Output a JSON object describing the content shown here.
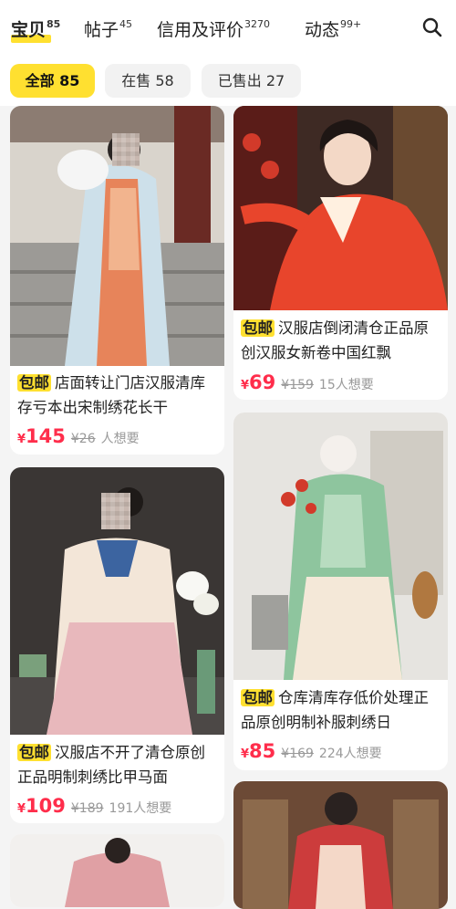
{
  "tabs": [
    {
      "label": "宝贝",
      "count": "85"
    },
    {
      "label": "帖子",
      "count": "45"
    },
    {
      "label": "信用及评价",
      "count": "3270"
    },
    {
      "label": "动态",
      "count": "99+"
    }
  ],
  "filters": [
    {
      "label": "全部 85"
    },
    {
      "label": "在售 58"
    },
    {
      "label": "已售出 27"
    }
  ],
  "icons": {
    "search": "search-icon"
  },
  "colors": {
    "accent": "#ffe030",
    "price": "#ff2d4b"
  },
  "products": [
    {
      "badge": "包邮",
      "title": "店面转让门店汉服清库存亏本出宋制绣花长干",
      "currency": "¥",
      "price": "145",
      "orig": "¥26",
      "want": "人想要"
    },
    {
      "badge": "包邮",
      "title": "汉服店倒闭清仓正品原创汉服女新卷中国红飘",
      "currency": "¥",
      "price": "69",
      "orig": "¥159",
      "want": "15人想要"
    },
    {
      "badge": "包邮",
      "title": "汉服店不开了清仓原创正品明制刺绣比甲马面",
      "currency": "¥",
      "price": "109",
      "orig": "¥189",
      "want": "191人想要"
    },
    {
      "badge": "包邮",
      "title": "仓库清库存低价处理正品原创明制补服刺绣日",
      "currency": "¥",
      "price": "85",
      "orig": "¥169",
      "want": "224人想要"
    }
  ]
}
